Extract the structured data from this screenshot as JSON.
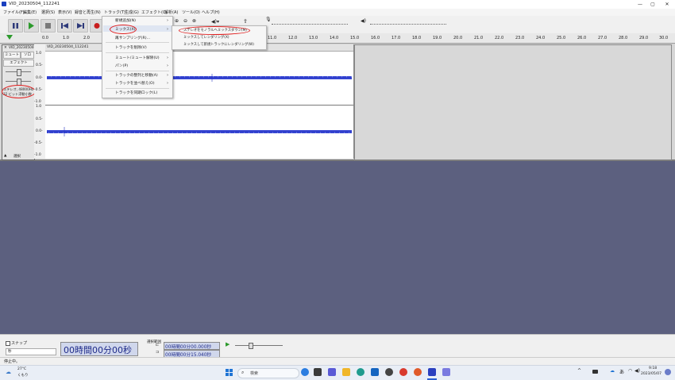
{
  "window": {
    "title": "VID_20230504_112241",
    "minimize": "—",
    "maximize": "▢",
    "close": "✕"
  },
  "menubar": [
    "ファイル(F)",
    "編集(E)",
    "選択(S)",
    "表示(V)",
    "録音と再生(N)",
    "トラック(T)",
    "生成(G)",
    "エフェクト(C)",
    "解析(A)",
    "ツール(O)",
    "ヘルプ(H)"
  ],
  "ruler": {
    "ticks": [
      "0.0",
      "1.0",
      "2.0",
      "11.0",
      "12.0",
      "13.0",
      "14.0",
      "15.0",
      "16.0",
      "17.0",
      "18.0",
      "19.0",
      "20.0",
      "21.0",
      "22.0",
      "23.0",
      "24.0",
      "25.0",
      "26.0",
      "27.0",
      "28.0",
      "29.0",
      "30.0"
    ]
  },
  "track_menu": {
    "items": [
      "新規追加(N)",
      "ミックス(X)",
      "再サンプリング(R)...",
      "トラックを削除(V)",
      "ミュート/ミュート解除(U)",
      "パン(P)",
      "トラックの整列と移動(A)",
      "トラックを並べ替え(O)",
      "トラックを同期ロック(L)"
    ]
  },
  "mix_submenu": {
    "items": [
      "ステレオをモノラルへミックスダウン(M)",
      "ミックスしてレンダリング(X)",
      "ミックスして新規トラックにレンダリング(W)"
    ]
  },
  "track": {
    "name": "VID_20230504▾",
    "mute": "ミュート",
    "solo": "ソロ",
    "effects": "エフェクト",
    "info_line1": "ステレオ, 48000Hz",
    "info_line2": "32 ビット浮動小数",
    "select": "選択",
    "clip_name": "VID_20230504_112241",
    "scale_labels": [
      "1.0",
      "0.5-",
      "0.0-",
      "-0.5-",
      "-1.0",
      "1.0",
      "0.5-",
      "0.0-",
      "-0.5-",
      "-1.0"
    ]
  },
  "bottom": {
    "snap_label": "スナップ",
    "snap_value": "秒",
    "time_display": "00時間00分00秒",
    "selection_label": "選択範囲",
    "sel_start": "00時間00分00.000秒",
    "sel_end": "00時間00分15.040秒",
    "status": "停止中。"
  },
  "taskbar": {
    "weather_temp": "27°C",
    "weather_desc": "くもり",
    "search_placeholder": "検索",
    "time": "9:18",
    "date": "2023/05/07",
    "lang": "あ"
  }
}
